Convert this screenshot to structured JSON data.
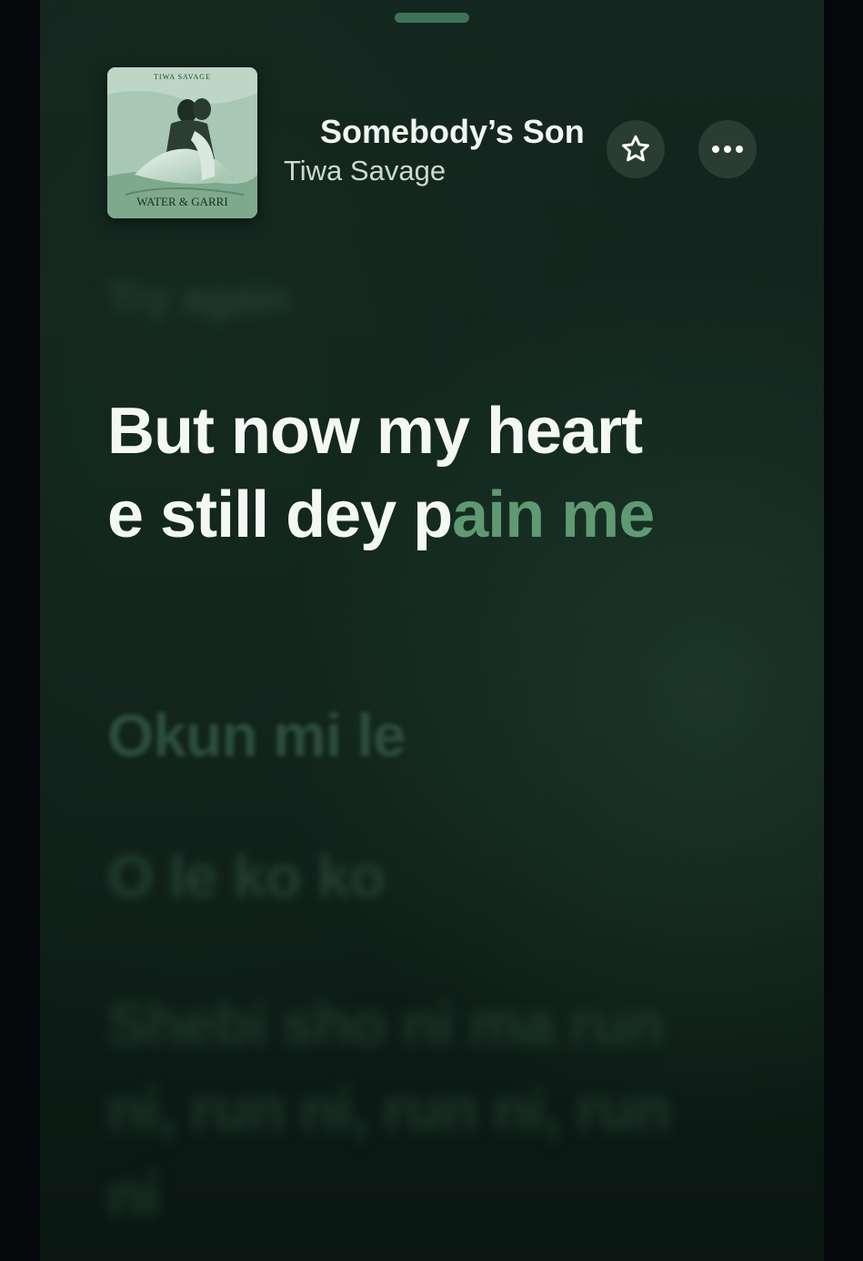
{
  "now_playing": {
    "title": "Somebody’s Son",
    "artist": "Tiwa Savage",
    "artwork": {
      "top_text": "TIWA SAVAGE",
      "bottom_text": "WATER & GARRI"
    },
    "actions": {
      "favorite_icon": "star-icon",
      "more_icon": "ellipsis-icon"
    }
  },
  "lyrics": {
    "previous_line": "Try again",
    "current_line": {
      "sung": "But now my heart e still dey p",
      "unsung": "ain me"
    },
    "upcoming_lines": [
      "Okun mi le",
      "O le ko ko",
      "Shebi sho ni ma run ni, run ni, run ni, run ni"
    ]
  },
  "colors": {
    "background": "#11241d",
    "accent_green": "#5f9a72",
    "text_primary": "#f4f8f5"
  }
}
